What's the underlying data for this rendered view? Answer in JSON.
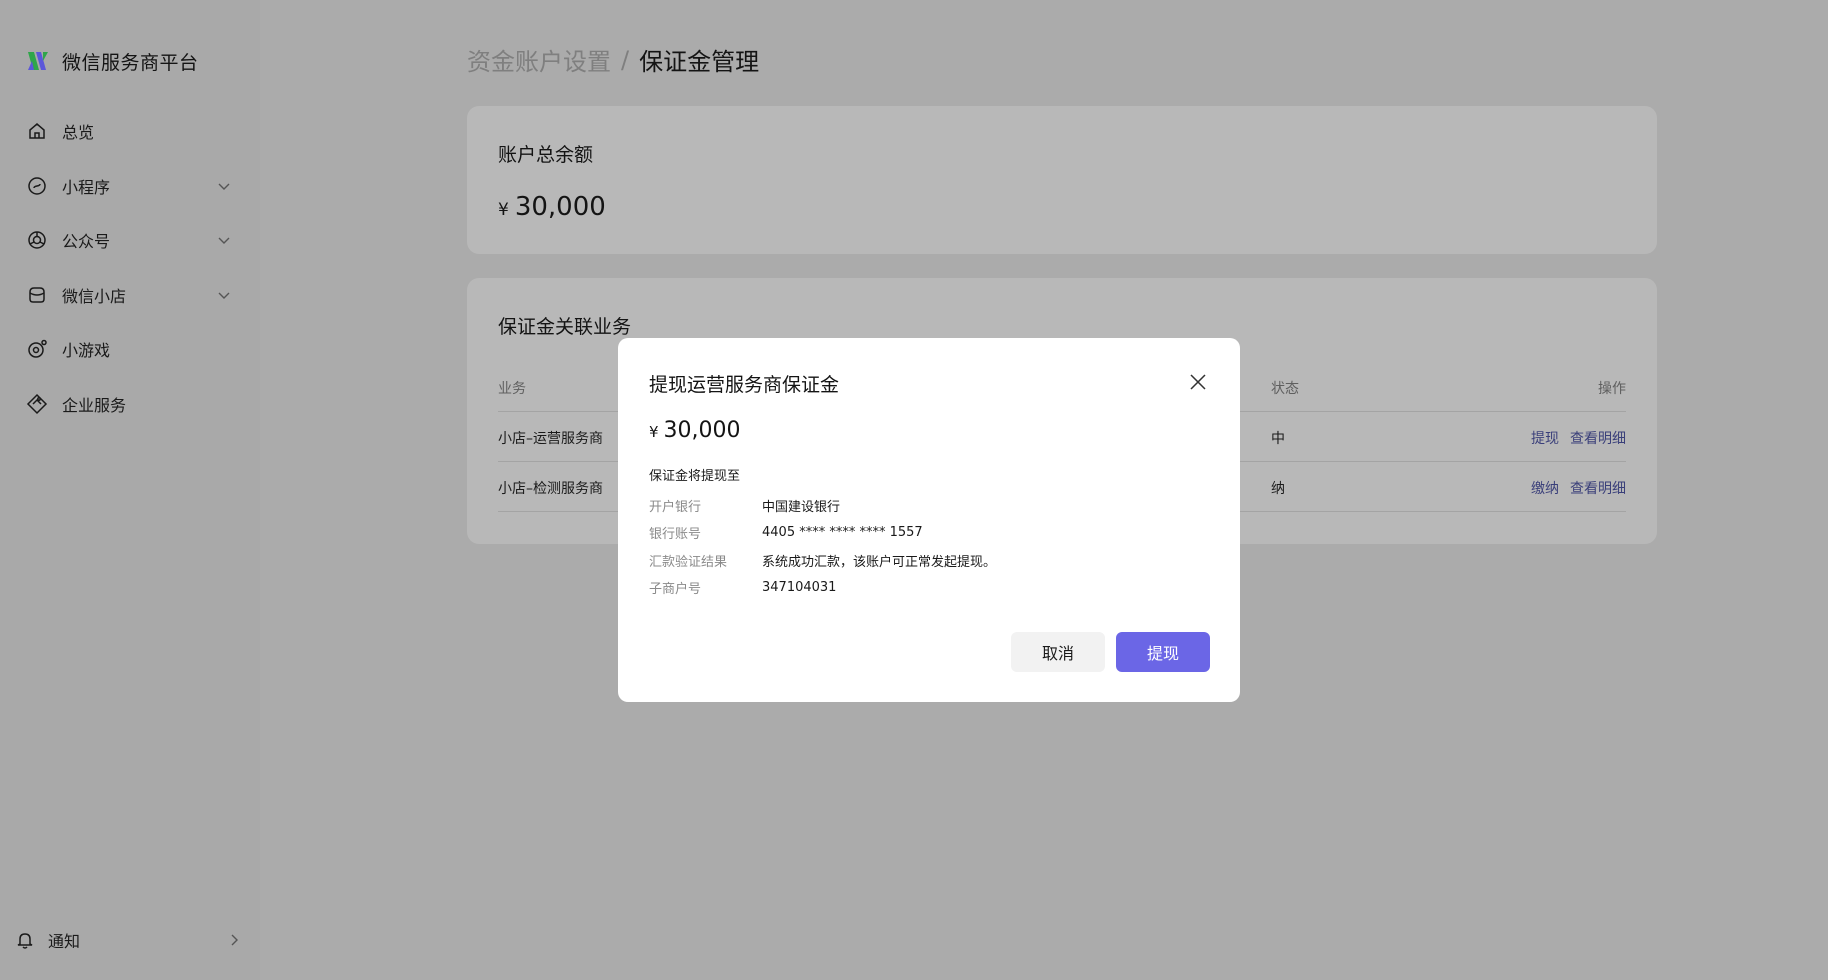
{
  "app": {
    "title": "微信服务商平台",
    "brand_colors": {
      "primary": "#6b66e6",
      "logo_green": "#2fa64a",
      "logo_blue": "#5b57d9"
    }
  },
  "sidebar": {
    "items": [
      {
        "label": "总览",
        "icon": "home-icon",
        "has_chevron": false
      },
      {
        "label": "小程序",
        "icon": "mini-program-icon",
        "has_chevron": true
      },
      {
        "label": "公众号",
        "icon": "official-account-icon",
        "has_chevron": true
      },
      {
        "label": "微信小店",
        "icon": "shop-icon",
        "has_chevron": true
      },
      {
        "label": "小游戏",
        "icon": "mini-game-icon",
        "has_chevron": false
      },
      {
        "label": "企业服务",
        "icon": "enterprise-icon",
        "has_chevron": false
      }
    ],
    "notice": {
      "label": "通知",
      "icon": "bell-icon"
    }
  },
  "breadcrumb": {
    "parent": "资金账户设置",
    "separator": "/",
    "current": "保证金管理"
  },
  "balance_card": {
    "title": "账户总余额",
    "currency": "¥",
    "amount": "30,000"
  },
  "business_card": {
    "title": "保证金关联业务",
    "columns": {
      "business": "业务",
      "status": "状态",
      "action": "操作"
    },
    "rows": [
      {
        "business": "小店–运营服务商",
        "status": "中",
        "actions": [
          "提现",
          "查看明细"
        ]
      },
      {
        "business": "小店–检测服务商",
        "status": "纳",
        "actions": [
          "缴纳",
          "查看明细"
        ]
      }
    ]
  },
  "modal": {
    "title": "提现运营服务商保证金",
    "currency": "¥",
    "amount": "30,000",
    "subtitle": "保证金将提现至",
    "fields": [
      {
        "label": "开户银行",
        "value": "中国建设银行"
      },
      {
        "label": "银行账号",
        "value": "4405 **** **** **** 1557"
      },
      {
        "label": "汇款验证结果",
        "value": "系统成功汇款，该账户可正常发起提现。"
      },
      {
        "label": "子商户号",
        "value": "347104031"
      }
    ],
    "cancel_label": "取消",
    "confirm_label": "提现"
  }
}
